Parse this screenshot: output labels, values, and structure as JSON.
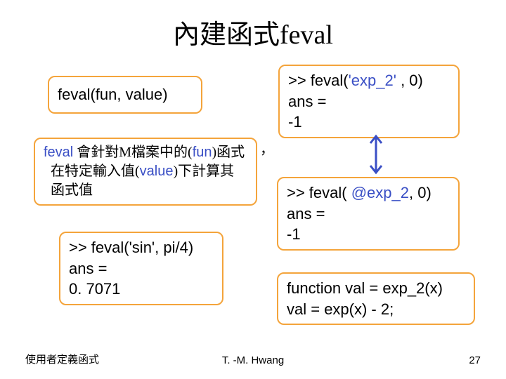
{
  "title": {
    "zh": "內建函式",
    "latin": "feval"
  },
  "syntax": "feval(fun, value)",
  "explanation": {
    "kw": "feval",
    "part1": " 會針對M檔案中的(",
    "fun": "fun",
    "part2": ")函式",
    "line2a": "在特定輸入值(",
    "value": "value",
    "line2b": ")下計算其",
    "line3": "函式值"
  },
  "comma_out": "，",
  "sin_example": {
    "l1": ">> feval('sin', pi/4)",
    "l2": "ans =",
    "l3": "   0. 7071"
  },
  "exp_str_example": {
    "l1a": ">> feval(",
    "l1b": "'exp_2'",
    "l1c": " , 0)",
    "l2": "ans =",
    "l3": "   -1"
  },
  "exp_handle_example": {
    "l1a": ">> feval( ",
    "l1b": "@exp_2",
    "l1c": ", 0)",
    "l2": "ans =",
    "l3": "   -1"
  },
  "func_def": {
    "l1": "function val = exp_2(x)",
    "l2": "val = exp(x) - 2;"
  },
  "footer": {
    "left": "使用者定義函式",
    "center": "T. -M. Hwang",
    "right": "27"
  },
  "colors": {
    "box_border": "#f4a43b",
    "keyword": "#3a4fc5",
    "arrow": "#3a4fc5"
  }
}
